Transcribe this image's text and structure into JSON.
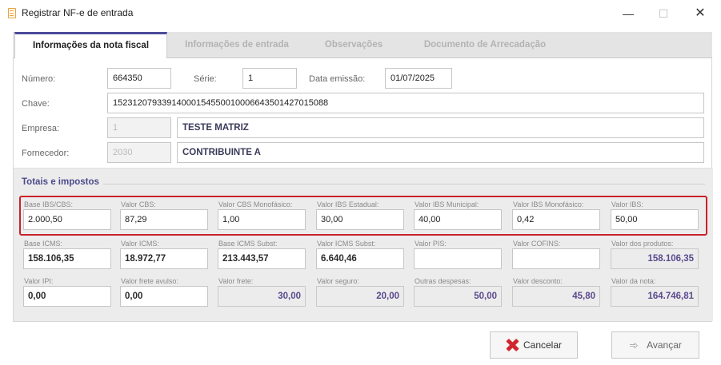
{
  "window": {
    "title": "Registrar NF-e de entrada",
    "minimize": "—",
    "maximize": "☐",
    "close": "✕"
  },
  "tabs": [
    {
      "label": "Informações da nota fiscal"
    },
    {
      "label": "Informações de entrada"
    },
    {
      "label": "Observações"
    },
    {
      "label": "Documento de Arrecadação"
    }
  ],
  "form": {
    "numero_label": "Número:",
    "numero": "664350",
    "serie_label": "Série:",
    "serie": "1",
    "data_label": "Data emissão:",
    "data": "01/07/2025",
    "chave_label": "Chave:",
    "chave": "15231207933914000154550010006643501427015088",
    "empresa_label": "Empresa:",
    "empresa_code": "1",
    "empresa_name": "TESTE MATRIZ",
    "fornecedor_label": "Fornecedor:",
    "fornecedor_code": "2030",
    "fornecedor_name": "CONTRIBUINTE A"
  },
  "totais": {
    "title": "Totais e impostos",
    "row1": [
      {
        "label": "Base IBS/CBS:",
        "value": "2.000,50"
      },
      {
        "label": "Valor CBS:",
        "value": "87,29"
      },
      {
        "label": "Valor CBS Monofásico:",
        "value": "1,00"
      },
      {
        "label": "Valor IBS Estadual:",
        "value": "30,00"
      },
      {
        "label": "Valor IBS Municipal:",
        "value": "40,00"
      },
      {
        "label": "Valor IBS Monofásico:",
        "value": "0,42"
      },
      {
        "label": "Valor IBS:",
        "value": "50,00"
      }
    ],
    "row2": [
      {
        "label": "Base ICMS:",
        "value": "158.106,35"
      },
      {
        "label": "Valor ICMS:",
        "value": "18.972,77"
      },
      {
        "label": "Base ICMS Subst:",
        "value": "213.443,57"
      },
      {
        "label": "Valor ICMS Subst:",
        "value": "6.640,46"
      },
      {
        "label": "Valor PIS:",
        "value": ""
      },
      {
        "label": "Valor COFINS:",
        "value": ""
      },
      {
        "label": "Valor dos produtos:",
        "value": "158.106,35"
      }
    ],
    "row3": [
      {
        "label": "Valor IPI:",
        "value": "0,00"
      },
      {
        "label": "Valor frete avulso:",
        "value": "0,00"
      },
      {
        "label": "Valor frete:",
        "value": "30,00"
      },
      {
        "label": "Valor seguro:",
        "value": "20,00"
      },
      {
        "label": "Outras despesas:",
        "value": "50,00"
      },
      {
        "label": "Valor desconto:",
        "value": "45,80"
      },
      {
        "label": "Valor da nota:",
        "value": "164.746,81"
      }
    ]
  },
  "footer": {
    "cancel_label": "Cancelar",
    "next_label": "Avançar"
  },
  "colors": {
    "accent": "#4c4c9a",
    "highlight": "#c9212b",
    "readonly_value": "#5a4a8e"
  }
}
